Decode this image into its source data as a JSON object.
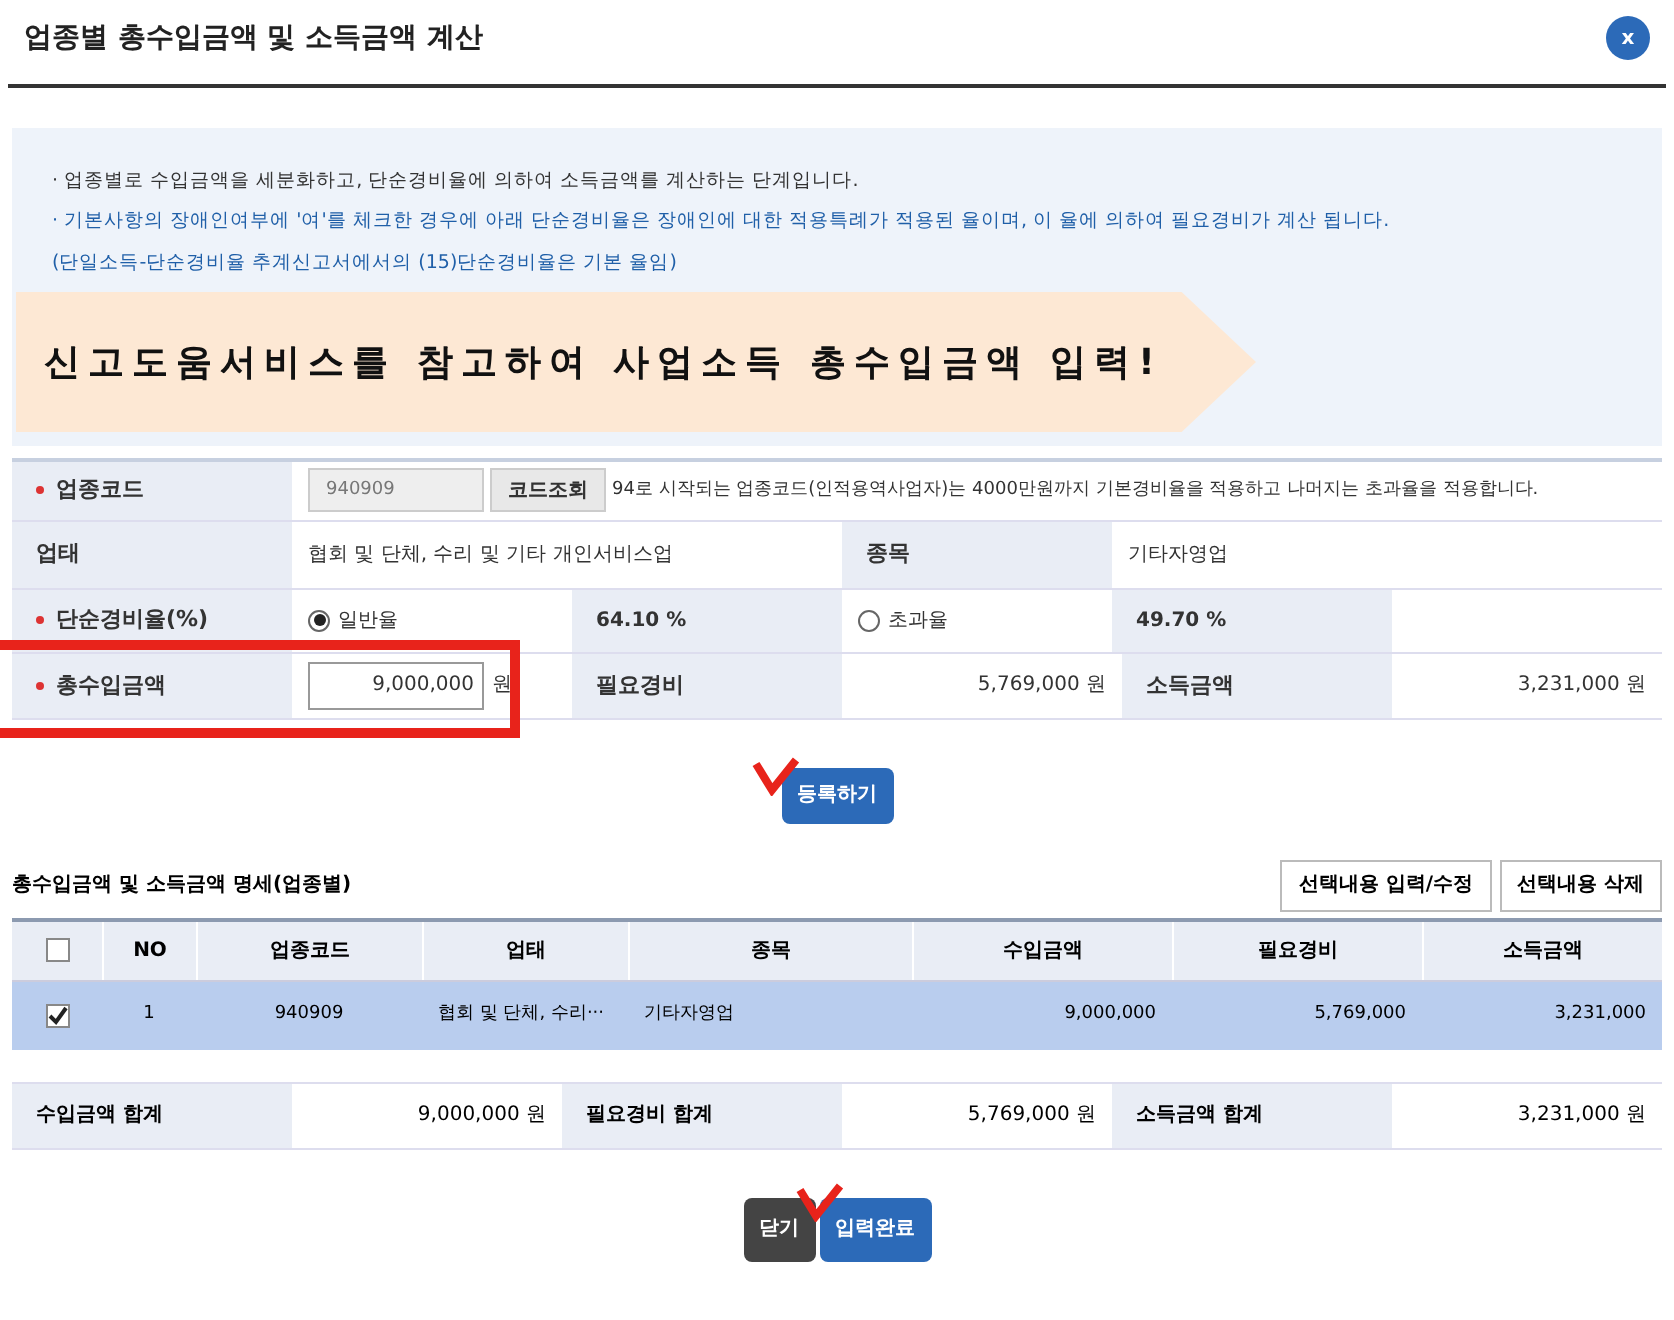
{
  "title": "업종별 총수입금액 및 소득금액 계산",
  "close_button": "x",
  "notices": [
    {
      "text": "· 업종별로 수입금액을 세분화하고, 단순경비율에 의하여 소득금액를 계산하는 단계입니다.",
      "color": "#333333"
    },
    {
      "text": "· 기본사항의 장애인여부에 '여'를 체크한 경우에 아래 단순경비율은 장애인에 대한 적용특례가 적용된 율이며, 이 율에 의하여 필요경비가 계산 됩니다.",
      "color": "#1f5fa8"
    },
    {
      "text": "(단일소득-단순경비율 추계신고서에서의 (15)단순경비율은 기본 율임)",
      "color": "#1f5fa8"
    }
  ],
  "callout": "신고도움서비스를 참고하여 사업소득 총수입금액 입력!",
  "form": {
    "code": {
      "label": "업종코드",
      "required": true,
      "value": "940909",
      "button": "코드조회",
      "hint": "94로 시작되는 업종코드(인적용역사업자)는 4000만원까지 기본경비율을 적용하고 나머지는 초과율을 적용합니다."
    },
    "business_type": {
      "label": "업태",
      "value": "협회 및 단체, 수리 및 기타 개인서비스업"
    },
    "item": {
      "label": "종목",
      "value": "기타자영업"
    },
    "rate": {
      "label": "단순경비율(%)",
      "required": true,
      "options": [
        {
          "label": "일반율",
          "selected": true,
          "rate": "64.10 %"
        },
        {
          "label": "초과율",
          "selected": false,
          "rate": "49.70 %"
        }
      ]
    },
    "income": {
      "label": "총수입금액",
      "required": true,
      "value": "9,000,000",
      "unit": "원"
    },
    "expense": {
      "label": "필요경비",
      "value": "5,769,000 원"
    },
    "profit": {
      "label": "소득금액",
      "value": "3,231,000 원"
    }
  },
  "register_button": "등록하기",
  "details": {
    "title": "총수입금액 및 소득금액 명세(업종별)",
    "buttons": [
      "선택내용 입력/수정",
      "선택내용 삭제"
    ],
    "all_checked": false,
    "columns": [
      "NO",
      "업종코드",
      "업태",
      "종목",
      "수입금액",
      "필요경비",
      "소득금액"
    ],
    "rows": [
      {
        "checked": true,
        "cells": [
          "1",
          "940909",
          "협회 및 단체, 수리···",
          "기타자영업",
          "9,000,000",
          "5,769,000",
          "3,231,000"
        ]
      }
    ]
  },
  "totals": [
    {
      "label": "수입금액 합계",
      "value": "9,000,000 원"
    },
    {
      "label": "필요경비 합계",
      "value": "5,769,000 원"
    },
    {
      "label": "소득금액 합계",
      "value": "3,231,000 원"
    }
  ],
  "footer_buttons": [
    {
      "label": "닫기",
      "kind": "dark"
    },
    {
      "label": "입력완료",
      "kind": "primary"
    }
  ]
}
